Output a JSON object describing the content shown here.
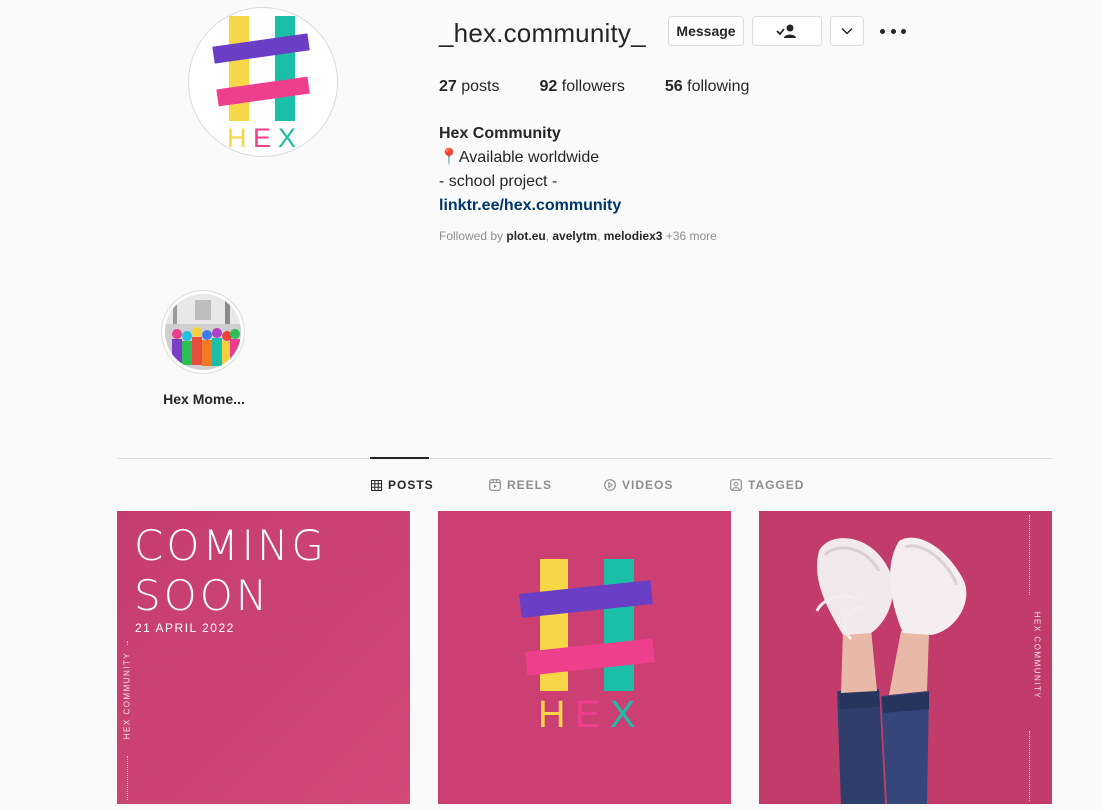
{
  "profile": {
    "username": "_hex.community_",
    "message_label": "Message",
    "stats": {
      "posts_count": "27",
      "posts_label": "posts",
      "followers_count": "92",
      "followers_label": "followers",
      "following_count": "56",
      "following_label": "following"
    },
    "bio": {
      "name": "Hex Community",
      "line1": "📍Available worldwide",
      "line2": "- school project -",
      "link": "linktr.ee/hex.community"
    },
    "followed_by": {
      "prefix": "Followed by",
      "users": [
        "plot.eu",
        "avelytm",
        "melodiex3"
      ],
      "more": "+36 more"
    }
  },
  "logo": {
    "letters": [
      "H",
      "E",
      "X"
    ]
  },
  "highlights": [
    {
      "label": "Hex Mome..."
    }
  ],
  "tabs": [
    {
      "label": "POSTS",
      "icon": "grid-icon",
      "active": true
    },
    {
      "label": "REELS",
      "icon": "reels-icon",
      "active": false
    },
    {
      "label": "VIDEOS",
      "icon": "play-icon",
      "active": false
    },
    {
      "label": "TAGGED",
      "icon": "tag-icon",
      "active": false
    }
  ],
  "posts": [
    {
      "line1": "COMING",
      "line2": "SOON",
      "date": "21 APRIL 2022",
      "side_text": "HEX COMMUNITY"
    },
    {
      "logo_letters": [
        "H",
        "E",
        "X"
      ]
    },
    {
      "side_text": "HEX COMMUNITY"
    }
  ],
  "colors": {
    "yellow": "#f7d748",
    "teal": "#1bbfa8",
    "purple": "#6a3fc6",
    "pink": "#ee3f8c",
    "post_bg": "#cc3f72",
    "link": "#00376b"
  }
}
